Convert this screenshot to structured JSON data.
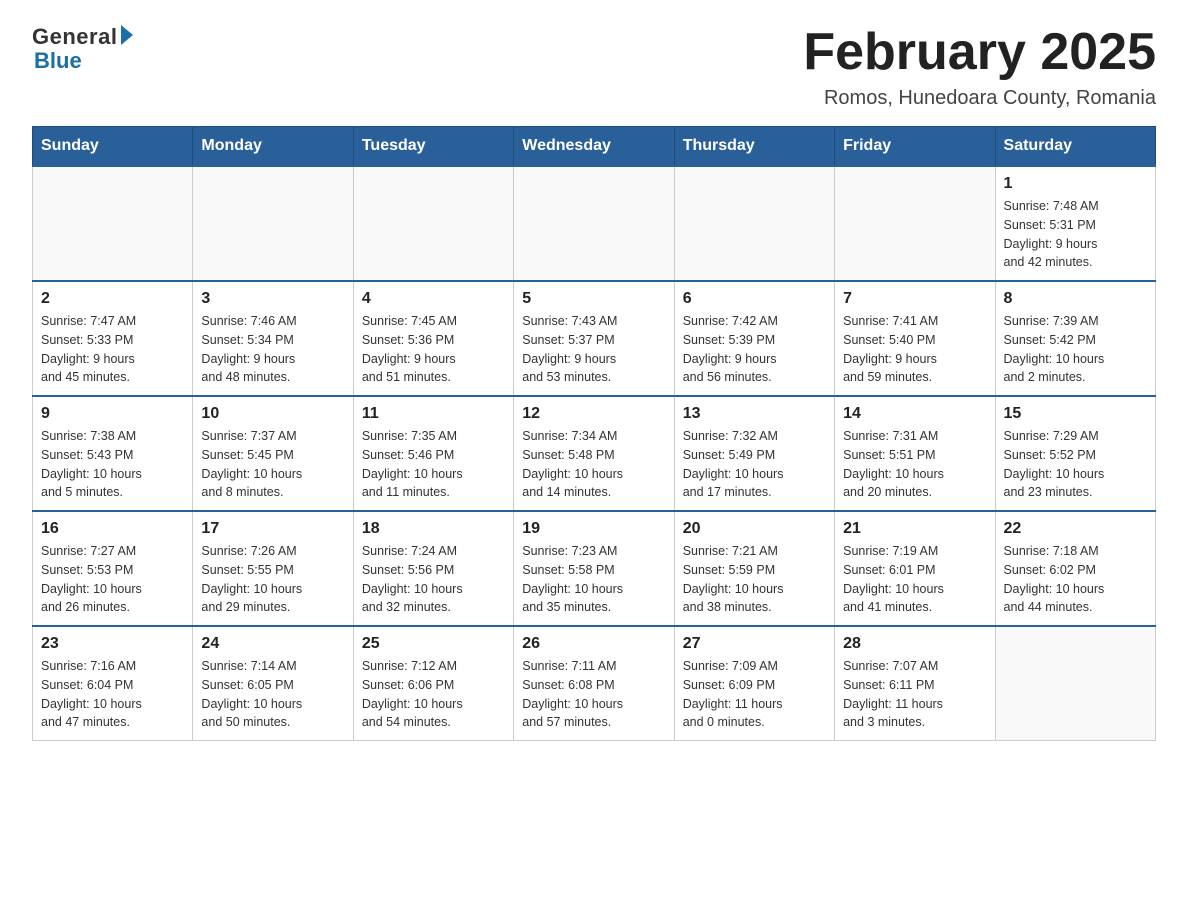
{
  "logo": {
    "general": "General",
    "blue": "Blue"
  },
  "title": "February 2025",
  "subtitle": "Romos, Hunedoara County, Romania",
  "weekdays": [
    "Sunday",
    "Monday",
    "Tuesday",
    "Wednesday",
    "Thursday",
    "Friday",
    "Saturday"
  ],
  "weeks": [
    [
      {
        "day": "",
        "info": ""
      },
      {
        "day": "",
        "info": ""
      },
      {
        "day": "",
        "info": ""
      },
      {
        "day": "",
        "info": ""
      },
      {
        "day": "",
        "info": ""
      },
      {
        "day": "",
        "info": ""
      },
      {
        "day": "1",
        "info": "Sunrise: 7:48 AM\nSunset: 5:31 PM\nDaylight: 9 hours\nand 42 minutes."
      }
    ],
    [
      {
        "day": "2",
        "info": "Sunrise: 7:47 AM\nSunset: 5:33 PM\nDaylight: 9 hours\nand 45 minutes."
      },
      {
        "day": "3",
        "info": "Sunrise: 7:46 AM\nSunset: 5:34 PM\nDaylight: 9 hours\nand 48 minutes."
      },
      {
        "day": "4",
        "info": "Sunrise: 7:45 AM\nSunset: 5:36 PM\nDaylight: 9 hours\nand 51 minutes."
      },
      {
        "day": "5",
        "info": "Sunrise: 7:43 AM\nSunset: 5:37 PM\nDaylight: 9 hours\nand 53 minutes."
      },
      {
        "day": "6",
        "info": "Sunrise: 7:42 AM\nSunset: 5:39 PM\nDaylight: 9 hours\nand 56 minutes."
      },
      {
        "day": "7",
        "info": "Sunrise: 7:41 AM\nSunset: 5:40 PM\nDaylight: 9 hours\nand 59 minutes."
      },
      {
        "day": "8",
        "info": "Sunrise: 7:39 AM\nSunset: 5:42 PM\nDaylight: 10 hours\nand 2 minutes."
      }
    ],
    [
      {
        "day": "9",
        "info": "Sunrise: 7:38 AM\nSunset: 5:43 PM\nDaylight: 10 hours\nand 5 minutes."
      },
      {
        "day": "10",
        "info": "Sunrise: 7:37 AM\nSunset: 5:45 PM\nDaylight: 10 hours\nand 8 minutes."
      },
      {
        "day": "11",
        "info": "Sunrise: 7:35 AM\nSunset: 5:46 PM\nDaylight: 10 hours\nand 11 minutes."
      },
      {
        "day": "12",
        "info": "Sunrise: 7:34 AM\nSunset: 5:48 PM\nDaylight: 10 hours\nand 14 minutes."
      },
      {
        "day": "13",
        "info": "Sunrise: 7:32 AM\nSunset: 5:49 PM\nDaylight: 10 hours\nand 17 minutes."
      },
      {
        "day": "14",
        "info": "Sunrise: 7:31 AM\nSunset: 5:51 PM\nDaylight: 10 hours\nand 20 minutes."
      },
      {
        "day": "15",
        "info": "Sunrise: 7:29 AM\nSunset: 5:52 PM\nDaylight: 10 hours\nand 23 minutes."
      }
    ],
    [
      {
        "day": "16",
        "info": "Sunrise: 7:27 AM\nSunset: 5:53 PM\nDaylight: 10 hours\nand 26 minutes."
      },
      {
        "day": "17",
        "info": "Sunrise: 7:26 AM\nSunset: 5:55 PM\nDaylight: 10 hours\nand 29 minutes."
      },
      {
        "day": "18",
        "info": "Sunrise: 7:24 AM\nSunset: 5:56 PM\nDaylight: 10 hours\nand 32 minutes."
      },
      {
        "day": "19",
        "info": "Sunrise: 7:23 AM\nSunset: 5:58 PM\nDaylight: 10 hours\nand 35 minutes."
      },
      {
        "day": "20",
        "info": "Sunrise: 7:21 AM\nSunset: 5:59 PM\nDaylight: 10 hours\nand 38 minutes."
      },
      {
        "day": "21",
        "info": "Sunrise: 7:19 AM\nSunset: 6:01 PM\nDaylight: 10 hours\nand 41 minutes."
      },
      {
        "day": "22",
        "info": "Sunrise: 7:18 AM\nSunset: 6:02 PM\nDaylight: 10 hours\nand 44 minutes."
      }
    ],
    [
      {
        "day": "23",
        "info": "Sunrise: 7:16 AM\nSunset: 6:04 PM\nDaylight: 10 hours\nand 47 minutes."
      },
      {
        "day": "24",
        "info": "Sunrise: 7:14 AM\nSunset: 6:05 PM\nDaylight: 10 hours\nand 50 minutes."
      },
      {
        "day": "25",
        "info": "Sunrise: 7:12 AM\nSunset: 6:06 PM\nDaylight: 10 hours\nand 54 minutes."
      },
      {
        "day": "26",
        "info": "Sunrise: 7:11 AM\nSunset: 6:08 PM\nDaylight: 10 hours\nand 57 minutes."
      },
      {
        "day": "27",
        "info": "Sunrise: 7:09 AM\nSunset: 6:09 PM\nDaylight: 11 hours\nand 0 minutes."
      },
      {
        "day": "28",
        "info": "Sunrise: 7:07 AM\nSunset: 6:11 PM\nDaylight: 11 hours\nand 3 minutes."
      },
      {
        "day": "",
        "info": ""
      }
    ]
  ]
}
